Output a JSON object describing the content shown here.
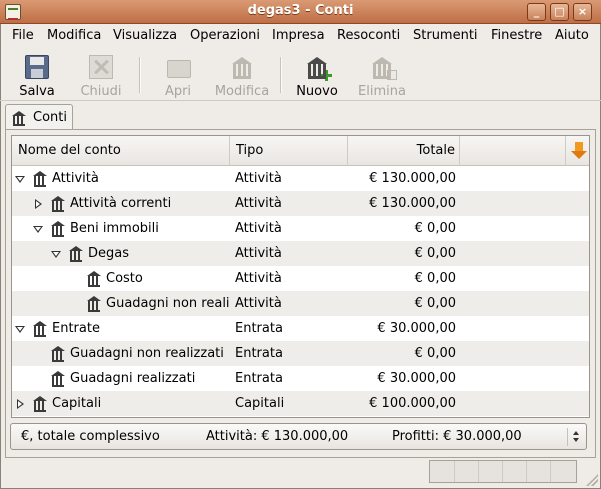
{
  "window": {
    "title": "degas3 - Conti",
    "minimize": "_",
    "maximize": "□",
    "close": "×"
  },
  "menu": [
    {
      "label": "File"
    },
    {
      "label": "Modifica"
    },
    {
      "label": "Visualizza"
    },
    {
      "label": "Operazioni"
    },
    {
      "label": "Impresa"
    },
    {
      "label": "Resoconti"
    },
    {
      "label": "Strumenti"
    },
    {
      "label": "Finestre"
    },
    {
      "label": "Aiuto"
    }
  ],
  "toolbar": {
    "save": "Salva",
    "close": "Chiudi",
    "open": "Apri",
    "edit": "Modifica",
    "new": "Nuovo",
    "delete": "Elimina"
  },
  "tab": {
    "label": "Conti"
  },
  "columns": {
    "name": "Nome del conto",
    "type": "Tipo",
    "total": "Totale"
  },
  "accounts": [
    {
      "name": "Attività",
      "type": "Attività",
      "total": "€ 130.000,00",
      "expander": "down"
    },
    {
      "name": "Attività correnti",
      "type": "Attività",
      "total": "€ 130.000,00",
      "expander": "right"
    },
    {
      "name": "Beni immobili",
      "type": "Attività",
      "total": "€ 0,00",
      "expander": "down"
    },
    {
      "name": "Degas",
      "type": "Attività",
      "total": "€ 0,00",
      "expander": "down"
    },
    {
      "name": "Costo",
      "type": "Attività",
      "total": "€ 0,00",
      "expander": "none"
    },
    {
      "name": "Guadagni non realizzati",
      "type": "Attività",
      "total": "€ 0,00",
      "expander": "none"
    },
    {
      "name": "Entrate",
      "type": "Entrata",
      "total": "€ 30.000,00",
      "expander": "down"
    },
    {
      "name": "Guadagni non realizzati",
      "type": "Entrata",
      "total": "€ 0,00",
      "expander": "none"
    },
    {
      "name": "Guadagni realizzati",
      "type": "Entrata",
      "total": "€ 30.000,00",
      "expander": "none"
    },
    {
      "name": "Capitali",
      "type": "Capitali",
      "total": "€ 100.000,00",
      "expander": "right"
    }
  ],
  "summary": {
    "currency": "€, totale complessivo",
    "assets": "Attività: € 130.000,00",
    "profits": "Profitti: € 30.000,00"
  }
}
